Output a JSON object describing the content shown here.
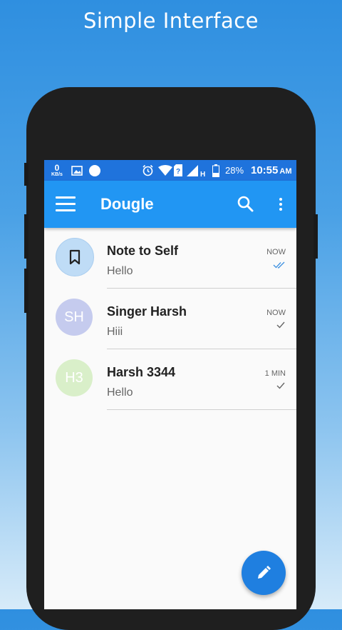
{
  "headline": "Simple Interface",
  "status_bar": {
    "speed_value": "0",
    "speed_unit": "KB/s",
    "battery": "28%",
    "time": "10:55",
    "ampm": "AM",
    "network": "H"
  },
  "app_bar": {
    "title": "Dougle"
  },
  "conversations": [
    {
      "name": "Note to Self",
      "message": "Hello",
      "time": "NOW",
      "avatar": "bookmark-icon",
      "avatar_color": "#bfdcf6",
      "tick": "double-check-icon"
    },
    {
      "name": "Singer Harsh",
      "message": "Hiii",
      "time": "NOW",
      "avatar_initials": "SH",
      "avatar_color": "#c5cbee",
      "tick": "check-icon"
    },
    {
      "name": "Harsh 3344",
      "message": "Hello",
      "time": "1 MIN",
      "avatar_initials": "H3",
      "avatar_color": "#d9efc9",
      "tick": "check-icon"
    }
  ],
  "colors": {
    "app_bar": "#2196f3",
    "status_bar": "#1f73dc",
    "fab": "#1f7fe0"
  }
}
